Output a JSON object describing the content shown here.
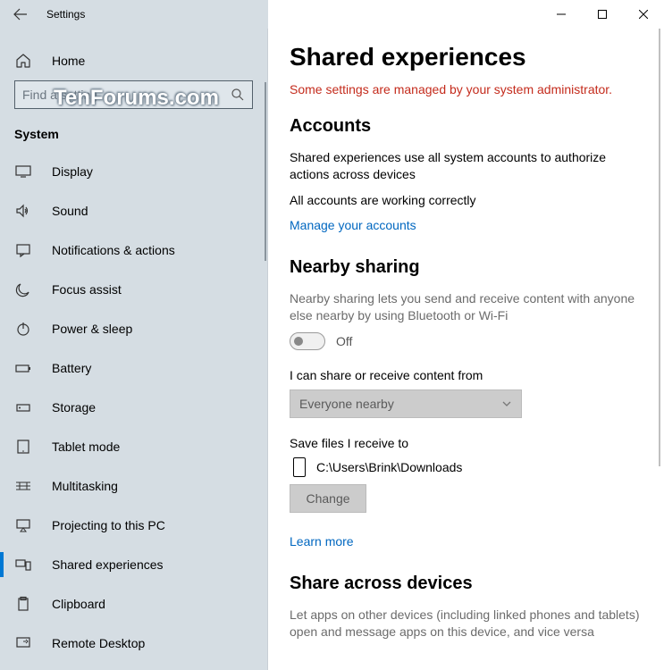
{
  "window": {
    "title": "Settings"
  },
  "watermark": "TenForums.com",
  "sidebar": {
    "home": "Home",
    "search_placeholder": "Find a setting",
    "section": "System",
    "items": [
      {
        "icon": "display",
        "label": "Display"
      },
      {
        "icon": "sound",
        "label": "Sound"
      },
      {
        "icon": "notifications",
        "label": "Notifications & actions"
      },
      {
        "icon": "focus",
        "label": "Focus assist"
      },
      {
        "icon": "power",
        "label": "Power & sleep"
      },
      {
        "icon": "battery",
        "label": "Battery"
      },
      {
        "icon": "storage",
        "label": "Storage"
      },
      {
        "icon": "tablet",
        "label": "Tablet mode"
      },
      {
        "icon": "multitask",
        "label": "Multitasking"
      },
      {
        "icon": "projecting",
        "label": "Projecting to this PC"
      },
      {
        "icon": "shared",
        "label": "Shared experiences"
      },
      {
        "icon": "clipboard",
        "label": "Clipboard"
      },
      {
        "icon": "remote",
        "label": "Remote Desktop"
      }
    ]
  },
  "main": {
    "title": "Shared experiences",
    "admin_note": "Some settings are managed by your system administrator.",
    "accounts": {
      "heading": "Accounts",
      "desc": "Shared experiences use all system accounts to authorize actions across devices",
      "status": "All accounts are working correctly",
      "manage_link": "Manage your accounts"
    },
    "nearby": {
      "heading": "Nearby sharing",
      "desc": "Nearby sharing lets you send and receive content with anyone else nearby by using Bluetooth or Wi-Fi",
      "toggle_state": "Off",
      "share_from_label": "I can share or receive content from",
      "share_from_value": "Everyone nearby",
      "save_to_label": "Save files I receive to",
      "save_to_path": "C:\\Users\\Brink\\Downloads",
      "change_btn": "Change",
      "learn_more": "Learn more"
    },
    "share_across": {
      "heading": "Share across devices",
      "desc": "Let apps on other devices (including linked phones and tablets) open and message apps on this device, and vice versa"
    }
  }
}
